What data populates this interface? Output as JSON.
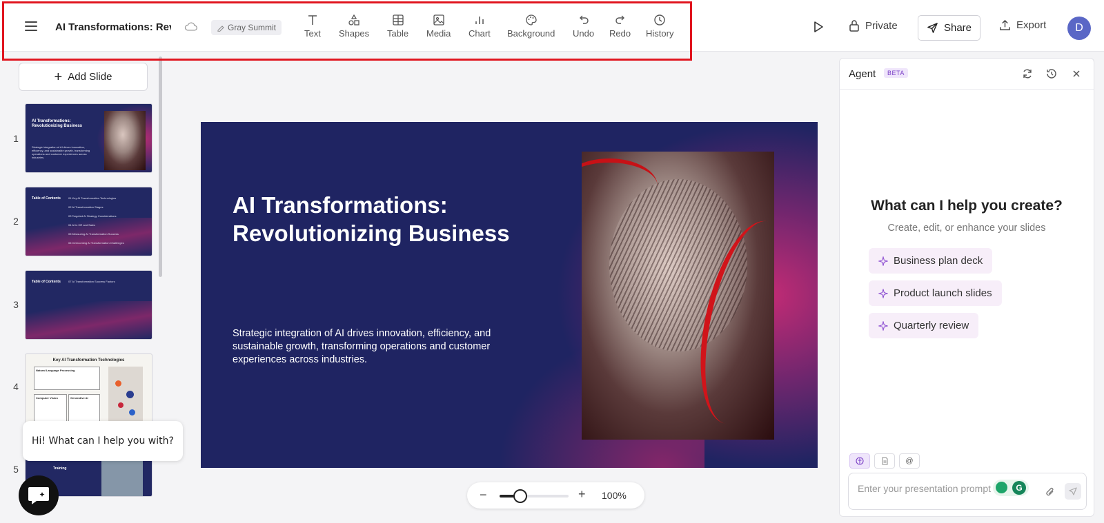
{
  "header": {
    "doc_title": "AI Transformations: Revolutionizing Business",
    "theme_chip": "Gray Summit",
    "tools": [
      {
        "label": "Text",
        "icon": "text-icon"
      },
      {
        "label": "Shapes",
        "icon": "shapes-icon"
      },
      {
        "label": "Table",
        "icon": "table-icon"
      },
      {
        "label": "Media",
        "icon": "media-icon"
      },
      {
        "label": "Chart",
        "icon": "chart-icon"
      },
      {
        "label": "Background",
        "icon": "palette-icon"
      },
      {
        "label": "Undo",
        "icon": "undo-icon"
      },
      {
        "label": "Redo",
        "icon": "redo-icon"
      },
      {
        "label": "History",
        "icon": "clock-icon"
      }
    ],
    "private_label": "Private",
    "share_label": "Share",
    "export_label": "Export",
    "avatar_initial": "D"
  },
  "slides_panel": {
    "add_slide_label": "Add Slide",
    "slides": [
      {
        "number": "1",
        "title": "AI Transformations: Revolutionizing Business",
        "body": "Strategic integration of AI drives innovation, efficiency, and sustainable growth, transforming operations and customer experiences across industries."
      },
      {
        "number": "2",
        "title": "Table of Contents",
        "items": [
          "01 Key AI Transformation Technologies",
          "02 AI Transformation Stages",
          "03 Targeted AI Strategy Considerations",
          "04 AI in HR and Sales",
          "05 Measuring AI Transformation Success",
          "06 Overcoming AI Transformation Challenges"
        ]
      },
      {
        "number": "3",
        "title": "Table of Contents",
        "items": [
          "07 AI Transformation Success Factors"
        ]
      },
      {
        "number": "4",
        "title": "Key AI Transformation Technologies",
        "boxes": [
          "Natural Language Processing",
          "Computer Vision",
          "Generative AI"
        ]
      },
      {
        "number": "5",
        "title": "Training"
      }
    ]
  },
  "chat_widget": {
    "bubble_text": "Hi! What can I help you with?"
  },
  "slide": {
    "title": "AI Transformations: Revolutionizing Business",
    "subtitle": "Strategic integration of AI drives innovation, efficiency, and sustainable growth, transforming operations and customer experiences across industries."
  },
  "zoom": {
    "value_label": "100%",
    "level_fraction": 0.3
  },
  "agent": {
    "title": "Agent",
    "badge": "BETA",
    "heading": "What can I help you create?",
    "subheading": "Create, edit, or enhance your slides",
    "suggestions": [
      "Business plan deck",
      "Product launch slides",
      "Quarterly review"
    ],
    "input_placeholder": "Enter your presentation prompt"
  },
  "colors": {
    "slide_bg": "#1f2462",
    "accent_pink": "#e12d78",
    "highlight_box": "#e0141e",
    "avatar": "#5a67c6"
  }
}
